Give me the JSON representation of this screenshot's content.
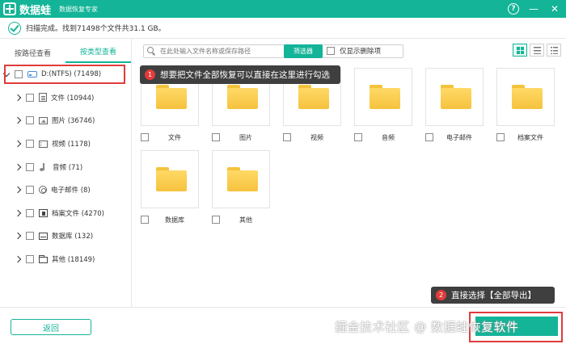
{
  "app": {
    "name": "数据蛙",
    "subtitle": "数据恢复专家"
  },
  "window": {
    "help": "?",
    "minimize": "—",
    "close": "✕"
  },
  "status": {
    "text": "扫描完成。找到71498个文件共31.1 GB。"
  },
  "view_tabs": [
    {
      "label": "按路径查看",
      "active": false
    },
    {
      "label": "按类型查看",
      "active": true
    }
  ],
  "tree": {
    "root": {
      "label": "D:(NTFS) (71498)",
      "icon": "drive-icon"
    },
    "items": [
      {
        "label": "文件 (10944)",
        "icon": "document-icon"
      },
      {
        "label": "图片 (36746)",
        "icon": "image-icon"
      },
      {
        "label": "视频 (1178)",
        "icon": "video-icon"
      },
      {
        "label": "音频 (71)",
        "icon": "audio-icon"
      },
      {
        "label": "电子邮件 (8)",
        "icon": "email-icon"
      },
      {
        "label": "档案文件 (4270)",
        "icon": "archive-icon"
      },
      {
        "label": "数据库 (132)",
        "icon": "database-icon"
      },
      {
        "label": "其他 (18149)",
        "icon": "folder-icon"
      }
    ]
  },
  "toolbar": {
    "search_placeholder": "在此处输入文件名称或保存路径",
    "filter_label": "筛选器",
    "deleted_only_label": "仅显示删除项"
  },
  "tiles": [
    "文件",
    "图片",
    "视频",
    "音频",
    "电子邮件",
    "档案文件",
    "数据库",
    "其他"
  ],
  "annotations": {
    "tip1_number": "1",
    "tip1_text": "想要把文件全部恢复可以直接在这里进行勾选",
    "tip2_number": "2",
    "tip2_text": "直接选择【全部导出】"
  },
  "footer": {
    "back_label": "返回",
    "watermark": "掘金技术社区 @ 数据蛙恢复软件"
  },
  "colors": {
    "accent": "#13b497",
    "highlight": "#e23b3b",
    "folder": "#f6c23e"
  }
}
